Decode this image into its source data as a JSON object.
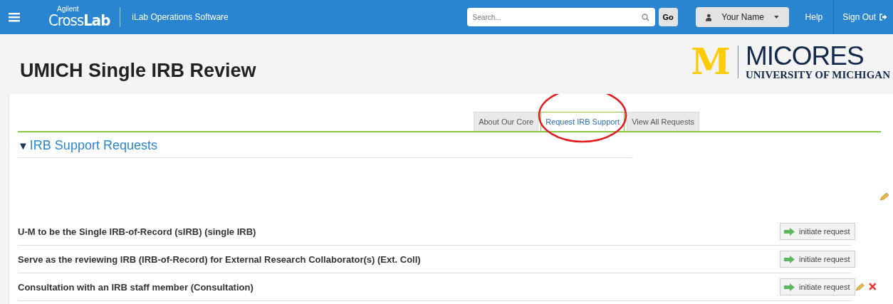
{
  "header": {
    "brand_small": "Agilent",
    "brand_thin": "Cross",
    "brand_bold": "Lab",
    "app_name": "iLab Operations Software",
    "search": {
      "placeholder": "Search..."
    },
    "go": "Go",
    "user": "Your Name",
    "help": "Help",
    "sign_out": "Sign Out"
  },
  "page": {
    "title": "UMICH Single IRB Review",
    "logo": {
      "letter": "M",
      "name": "MICORES",
      "subtitle": "UNIVERSITY OF MICHIGAN"
    }
  },
  "tabs": [
    {
      "label": "About Our Core",
      "selected": false
    },
    {
      "label": "Request IRB Support",
      "selected": true
    },
    {
      "label": "View All Requests",
      "selected": false
    }
  ],
  "section": {
    "marker": "▼",
    "title": "IRB Support Requests",
    "expanded": true
  },
  "requests": [
    {
      "name": "U-M to be the Single IRB-of-Record (sIRB) (single IRB)",
      "button": "initiate request",
      "editable": false
    },
    {
      "name": "Serve as the reviewing IRB (IRB-of-Record) for External Research Collaborator(s) (Ext. Coll)",
      "button": "initiate request",
      "editable": false
    },
    {
      "name": "Consultation with an IRB staff member (Consultation)",
      "button": "initiate request",
      "editable": true
    }
  ]
}
